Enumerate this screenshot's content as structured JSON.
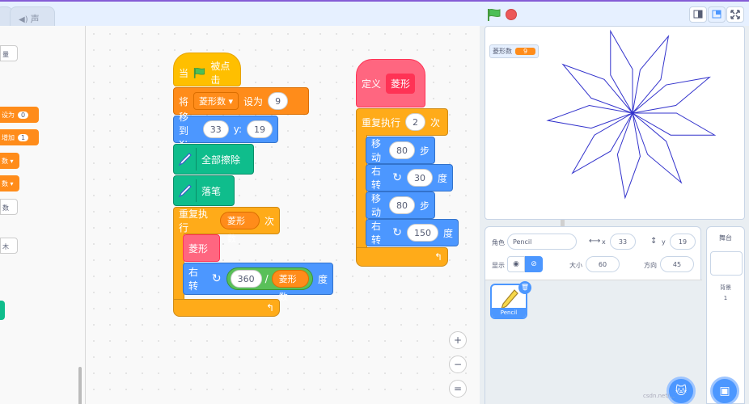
{
  "tabs": {
    "code": "",
    "sound": "声音"
  },
  "palette": {
    "items": [
      {
        "text": "量"
      },
      {
        "text": "设为",
        "value": "0"
      },
      {
        "text": "增加",
        "value": "1"
      },
      {
        "text": "数 ▾"
      },
      {
        "text": "数 ▾"
      },
      {
        "text": "数"
      },
      {
        "text": "木"
      }
    ]
  },
  "scripts": {
    "main": {
      "hat": {
        "label": "当",
        "suffix": "被点击"
      },
      "set": {
        "label": "将",
        "variable": "菱形数",
        "mid": "设为",
        "value": "9"
      },
      "goto": {
        "label": "移到 x:",
        "x": "33",
        "ylabel": "y:",
        "y": "19"
      },
      "clear": {
        "label": "全部擦除"
      },
      "pendown": {
        "label": "落笔"
      },
      "repeat": {
        "label": "重复执行",
        "count": "菱形数",
        "suffix": "次"
      },
      "call": {
        "label": "菱形"
      },
      "turn": {
        "label": "右转",
        "num": "360",
        "op": "/",
        "var": "菱形数",
        "suffix": "度"
      }
    },
    "define": {
      "label": "定义",
      "name": "菱形",
      "repeat": {
        "label": "重复执行",
        "count": "2",
        "suffix": "次"
      },
      "move1": {
        "label": "移动",
        "value": "80",
        "suffix": "步"
      },
      "turn1": {
        "label": "右转",
        "value": "30",
        "suffix": "度"
      },
      "move2": {
        "label": "移动",
        "value": "80",
        "suffix": "步"
      },
      "turn2": {
        "label": "右转",
        "value": "150",
        "suffix": "度"
      }
    }
  },
  "zoom": {
    "in": "+",
    "out": "−",
    "reset": "="
  },
  "stage": {
    "monitor_label": "菱形数",
    "monitor_value": "9",
    "rhombus_count": 9,
    "move_steps": 80,
    "first_turn_deg": 30,
    "line_color": "#3333cc"
  },
  "sprite_info": {
    "sprite_label": "角色",
    "sprite_name": "Pencil",
    "x_label": "x",
    "x": "33",
    "y_label": "y",
    "y": "19",
    "show_label": "显示",
    "size_label": "大小",
    "size": "60",
    "direction_label": "方向",
    "direction": "45"
  },
  "sprites": [
    {
      "name": "Pencil"
    }
  ],
  "stage_panel": {
    "title": "舞台",
    "backdrops_label": "背景",
    "backdrops_count": "1"
  },
  "watermark": "csdn.net/...",
  "colors": {
    "motion": "#4c97ff",
    "events": "#ffbf00",
    "control": "#ffab19",
    "variables": "#ff8c1a",
    "pen": "#0fbd8c",
    "operators": "#59c059",
    "myblocks": "#ff6680"
  }
}
